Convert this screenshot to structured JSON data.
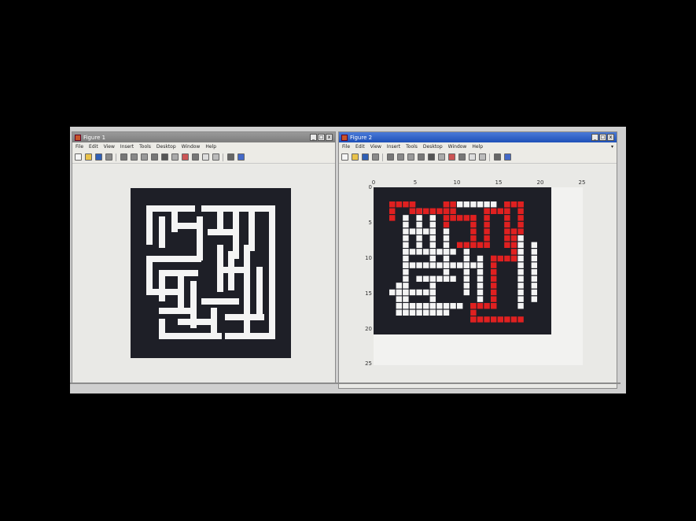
{
  "windows": [
    {
      "title": "Figure 1",
      "menu": [
        "File",
        "Edit",
        "View",
        "Insert",
        "Tools",
        "Desktop",
        "Window",
        "Help"
      ]
    },
    {
      "title": "Figure 2",
      "menu": [
        "File",
        "Edit",
        "View",
        "Insert",
        "Tools",
        "Desktop",
        "Window",
        "Help"
      ],
      "x_ticks": [
        "0",
        "5",
        "10",
        "15",
        "20",
        "25"
      ],
      "y_ticks": [
        "0",
        "5",
        "10",
        "15",
        "20",
        "25"
      ]
    }
  ],
  "colors": {
    "maze_wall": "#1e1f27",
    "maze_path": "#f4f4f4",
    "solution": "#e02020",
    "active_titlebar": "#2c5cc8"
  },
  "titlebar_buttons": [
    "_",
    "□",
    "x"
  ],
  "toolbar_icons": [
    "new-figure-icon",
    "open-file-icon",
    "save-icon",
    "print-icon",
    "pointer-icon",
    "zoom-in-icon",
    "zoom-out-icon",
    "pan-icon",
    "rotate-icon",
    "data-cursor-icon",
    "brush-icon",
    "link-icon",
    "colorbar-icon",
    "legend-icon",
    "hide-plot-tools-icon",
    "show-plot-tools-icon"
  ]
}
